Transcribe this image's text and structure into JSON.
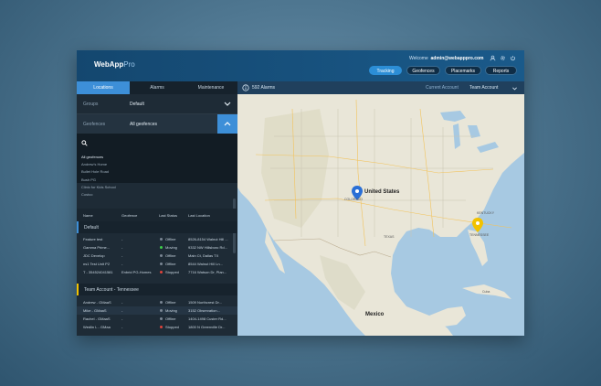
{
  "app": {
    "logo_main": "WebApp",
    "logo_pro": "Pro"
  },
  "header": {
    "welcome_label": "Welcome",
    "user_email": "admin@webapppro.com",
    "nav": [
      {
        "label": "Tracking",
        "active": true
      },
      {
        "label": "Geofences",
        "active": false
      },
      {
        "label": "Placemarks",
        "active": false
      },
      {
        "label": "Reports",
        "active": false
      }
    ]
  },
  "sidebar": {
    "tabs": [
      {
        "label": "Locations",
        "active": true
      },
      {
        "label": "Alarms",
        "active": false
      },
      {
        "label": "Maintenance",
        "active": false
      }
    ],
    "groups": {
      "label": "Groups",
      "value": "Default"
    },
    "geofences": {
      "label": "Geofences",
      "value": "All geofences"
    },
    "geofence_list": [
      "All geofences",
      "Andrew's Home",
      "Bullet Hole Road",
      "Bush PG",
      "Clinic for Kids School",
      "Costco"
    ],
    "table": {
      "headers": [
        "Name",
        "Geofence",
        "Last Status",
        "Last Location"
      ],
      "groups": [
        {
          "title": "Default",
          "rows": [
            {
              "name": "Feature test",
              "geofence": "-",
              "status": "Offline",
              "location": "8526-8154 Walnut Hill ...",
              "color": "#7b8794"
            },
            {
              "name": "Gamma Prime...",
              "geofence": "-",
              "status": "Moving",
              "location": "9332 NW Hillsboro Rd...",
              "color": "#3ecf4a"
            },
            {
              "name": "JDC Develop",
              "geofence": "-",
              "status": "Offline",
              "location": "Main Ct, Dallas TX",
              "color": "#7b8794"
            },
            {
              "name": "ns1 Test Unit P2",
              "geofence": "-",
              "status": "Offline",
              "location": "8544 Walnut Hill Ln...",
              "color": "#7b8794"
            },
            {
              "name": "T - 354524041581",
              "geofence": "Enbrid PG-Homes",
              "status": "Stopped",
              "location": "7716 Watson Dr, Plan...",
              "color": "#e0433a"
            }
          ]
        },
        {
          "title": "Team Account - Tennessee",
          "rows": [
            {
              "name": "Andrew - GMaaS",
              "geofence": "-",
              "status": "Offline",
              "location": "1509 Northcrest Dr...",
              "color": "#7b8794"
            },
            {
              "name": "Mike - GMaaS",
              "geofence": "-",
              "status": "Moving",
              "location": "3152 Observation...",
              "color": "#7b8794",
              "selected": true
            },
            {
              "name": "Rachel - GMaaS",
              "geofence": "-",
              "status": "Offline",
              "location": "1404-1498 Custer Rd...",
              "color": "#7b8794"
            },
            {
              "name": "Wedlin L - GMaa",
              "geofence": "-",
              "status": "Stopped",
              "location": "1800 N Greenville Dr...",
              "color": "#e0433a"
            }
          ]
        }
      ]
    }
  },
  "map": {
    "alarms": "592 Alarms",
    "current_account_label": "Current Account",
    "account": "Team Account",
    "labels": {
      "us": "United States",
      "mexico": "Mexico",
      "colorado": "COLORADO",
      "tennessee": "TENNESSEE",
      "texas": "TEXAS",
      "kentucky": "KENTUCKY",
      "cuba": "Cuba"
    },
    "pin_blue": "#2a6fd6",
    "pin_yellow": "#f2c200"
  }
}
